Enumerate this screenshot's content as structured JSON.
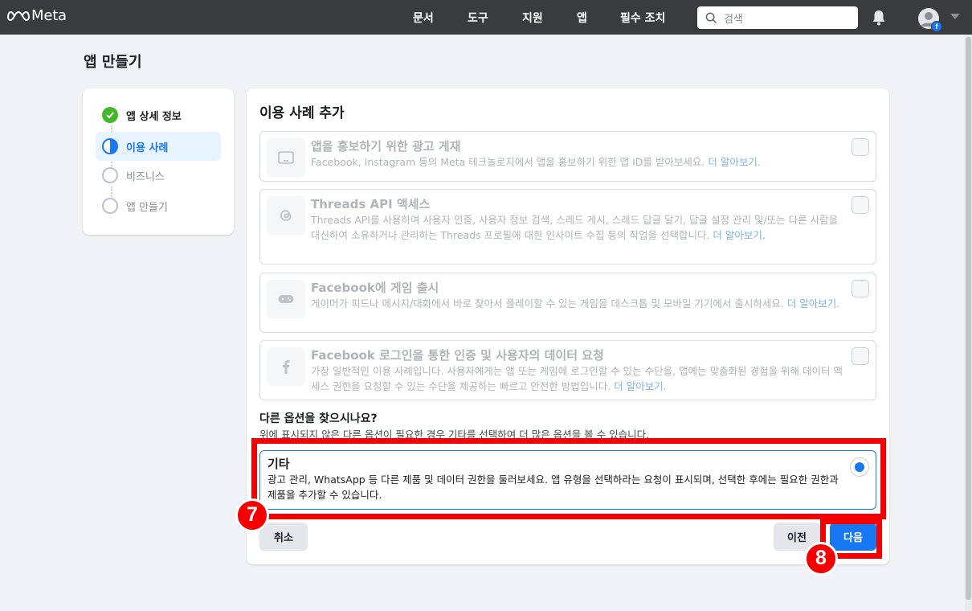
{
  "nav": {
    "brand": "Meta",
    "links": [
      "문서",
      "도구",
      "지원",
      "앱",
      "필수 조치"
    ],
    "search_placeholder": "검색"
  },
  "page": {
    "title": "앱 만들기"
  },
  "steps": [
    {
      "label": "앱 상세 정보",
      "state": "done"
    },
    {
      "label": "이용 사례",
      "state": "active"
    },
    {
      "label": "비즈니스",
      "state": "pending"
    },
    {
      "label": "앱 만들기",
      "state": "pending"
    }
  ],
  "card": {
    "title": "이용 사례 추가",
    "learn_more": "더 알아보기.",
    "options": [
      {
        "title": "앱을 홍보하기 위한 광고 게재",
        "desc": "Facebook, Instagram 등의 Meta 테크놀로지에서 앱을 홍보하기 위한 앱 ID를 받아보세요.",
        "icon": "tablet-icon",
        "checked": false
      },
      {
        "title": "Threads API 액세스",
        "desc": "Threads API를 사용하여 사용자 인증, 사용자 정보 검색, 스레드 게시, 스레드 답글 달기, 답글 설정 관리 및/또는 다른 사람을 대신하여 소유하거나 관리하는 Threads 프로필에 대한 인사이트 수집 등의 작업을 선택합니다.",
        "icon": "threads-icon",
        "checked": false
      },
      {
        "title": "Facebook에 게임 출시",
        "desc": "게이머가 피드나 메시지/대화에서 바로 찾아서 플레이할 수 있는 게임을 데스크톱 및 모바일 기기에서 출시하세요.",
        "icon": "gamepad-icon",
        "checked": false
      },
      {
        "title": "Facebook 로그인을 통한 인증 및 사용자의 데이터 요청",
        "desc": "가장 일반적인 이용 사례입니다. 사용자에게는 앱 또는 게임에 로그인할 수 있는 수단을, 앱에는 맞춤화된 경험을 위해 데이터 액세스 권한을 요청할 수 있는 수단을 제공하는 빠르고 안전한 방법입니다.",
        "icon": "facebook-icon",
        "checked": false
      }
    ],
    "more": {
      "title": "다른 옵션을 찾으시나요?",
      "subtitle": "위에 표시되지 않은 다른 옵션이 필요한 경우 기타를 선택하여 더 많은 옵션을 볼 수 있습니다."
    },
    "other": {
      "title": "기타",
      "desc": "광고 관리, WhatsApp 등 다른 제품 및 데이터 권한을 둘러보세요. 앱 유형을 선택하라는 요청이 표시되며, 선택한 후에는 필요한 권한과 제품을 추가할 수 있습니다.",
      "selected": true
    },
    "buttons": {
      "cancel": "취소",
      "previous": "이전",
      "next": "다음"
    }
  },
  "annotations": {
    "marker_a": "7",
    "marker_b": "8",
    "color": "#f50000"
  },
  "colors": {
    "accent": "#1877f2",
    "success": "#42b72a",
    "nav_bg": "#3a3b3c"
  }
}
